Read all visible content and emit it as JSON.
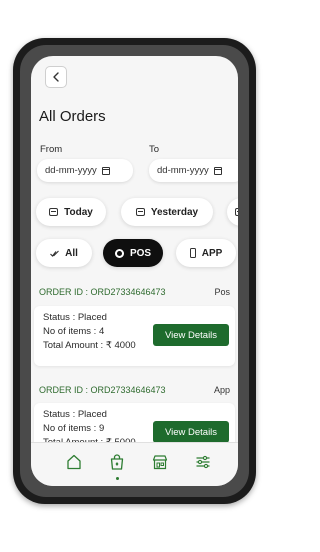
{
  "colors": {
    "accent": "#1e6b2d",
    "order_id": "#2f6b2f",
    "active_chip": "#0f0f0f"
  },
  "header": {
    "title": "All Orders",
    "back_icon": "chevron-left-icon"
  },
  "filters": {
    "from_label": "From",
    "to_label": "To",
    "from_placeholder": "dd-mm-yyyy",
    "to_placeholder": "dd-mm-yyyy",
    "date_chips": [
      "Today",
      "Yesterday"
    ],
    "source_chips": [
      "All",
      "POS",
      "APP"
    ],
    "selected_source": "POS"
  },
  "orders": [
    {
      "id": "ORDER ID : ORD27334646473",
      "source": "Pos",
      "status": "Status : Placed",
      "items": "No of items : 4",
      "total": "Total Amount : ₹ 4000",
      "action": "View Details"
    },
    {
      "id": "ORDER ID : ORD27334646473",
      "source": "App",
      "status": "Status : Placed",
      "items": "No of items : 9",
      "total": "Total Amount : ₹ 5000",
      "action": "View Details"
    }
  ],
  "bottom_nav": {
    "items": [
      "home-icon",
      "shopping-bag-icon",
      "store-icon",
      "sliders-icon"
    ],
    "active": "shopping-bag-icon"
  }
}
